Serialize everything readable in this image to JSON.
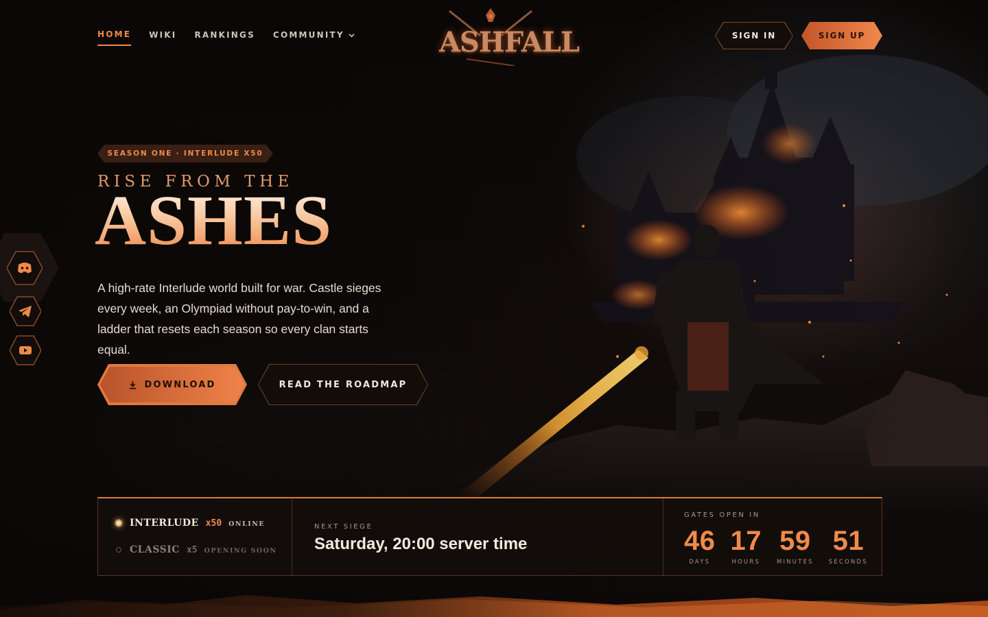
{
  "nav": {
    "links": [
      {
        "label": "HOME"
      },
      {
        "label": "WIKI"
      },
      {
        "label": "RANKINGS"
      },
      {
        "label": "COMMUNITY"
      }
    ],
    "logo_text": "ASHFALL",
    "sign_in": "SIGN IN",
    "sign_up": "SIGN UP"
  },
  "social": [
    {
      "icon": "discord-icon"
    },
    {
      "icon": "telegram-icon"
    },
    {
      "icon": "youtube-icon"
    }
  ],
  "hero": {
    "badge": "SEASON ONE · INTERLUDE X50",
    "kicker": "RISE FROM THE",
    "headline": "ASHES",
    "lede": "A high-rate Interlude world built for war. Castle sieges every week, an Olympiad without pay-to-win, and a ladder that resets each season so every clan starts equal.",
    "download_label": "DOWNLOAD",
    "roadmap_label": "READ THE ROADMAP"
  },
  "status": {
    "servers": [
      {
        "name": "INTERLUDE",
        "rate": "x50",
        "state": "ONLINE"
      },
      {
        "name": "CLASSIC",
        "rate": "x5",
        "state": "OPENING SOON"
      }
    ],
    "siege_label": "NEXT SIEGE",
    "siege_value": "Saturday, 20:00 server time",
    "timer_label": "GATES OPEN IN",
    "timer": [
      {
        "value": "46",
        "unit": "DAYS"
      },
      {
        "value": "17",
        "unit": "HOURS"
      },
      {
        "value": "59",
        "unit": "MINUTES"
      },
      {
        "value": "51",
        "unit": "SECONDS"
      }
    ]
  },
  "colors": {
    "accent": "#f08a4b",
    "accent_dark": "#b9522a",
    "background": "#0b0807",
    "online": "#f6dca0",
    "muted": "#a8978a"
  }
}
